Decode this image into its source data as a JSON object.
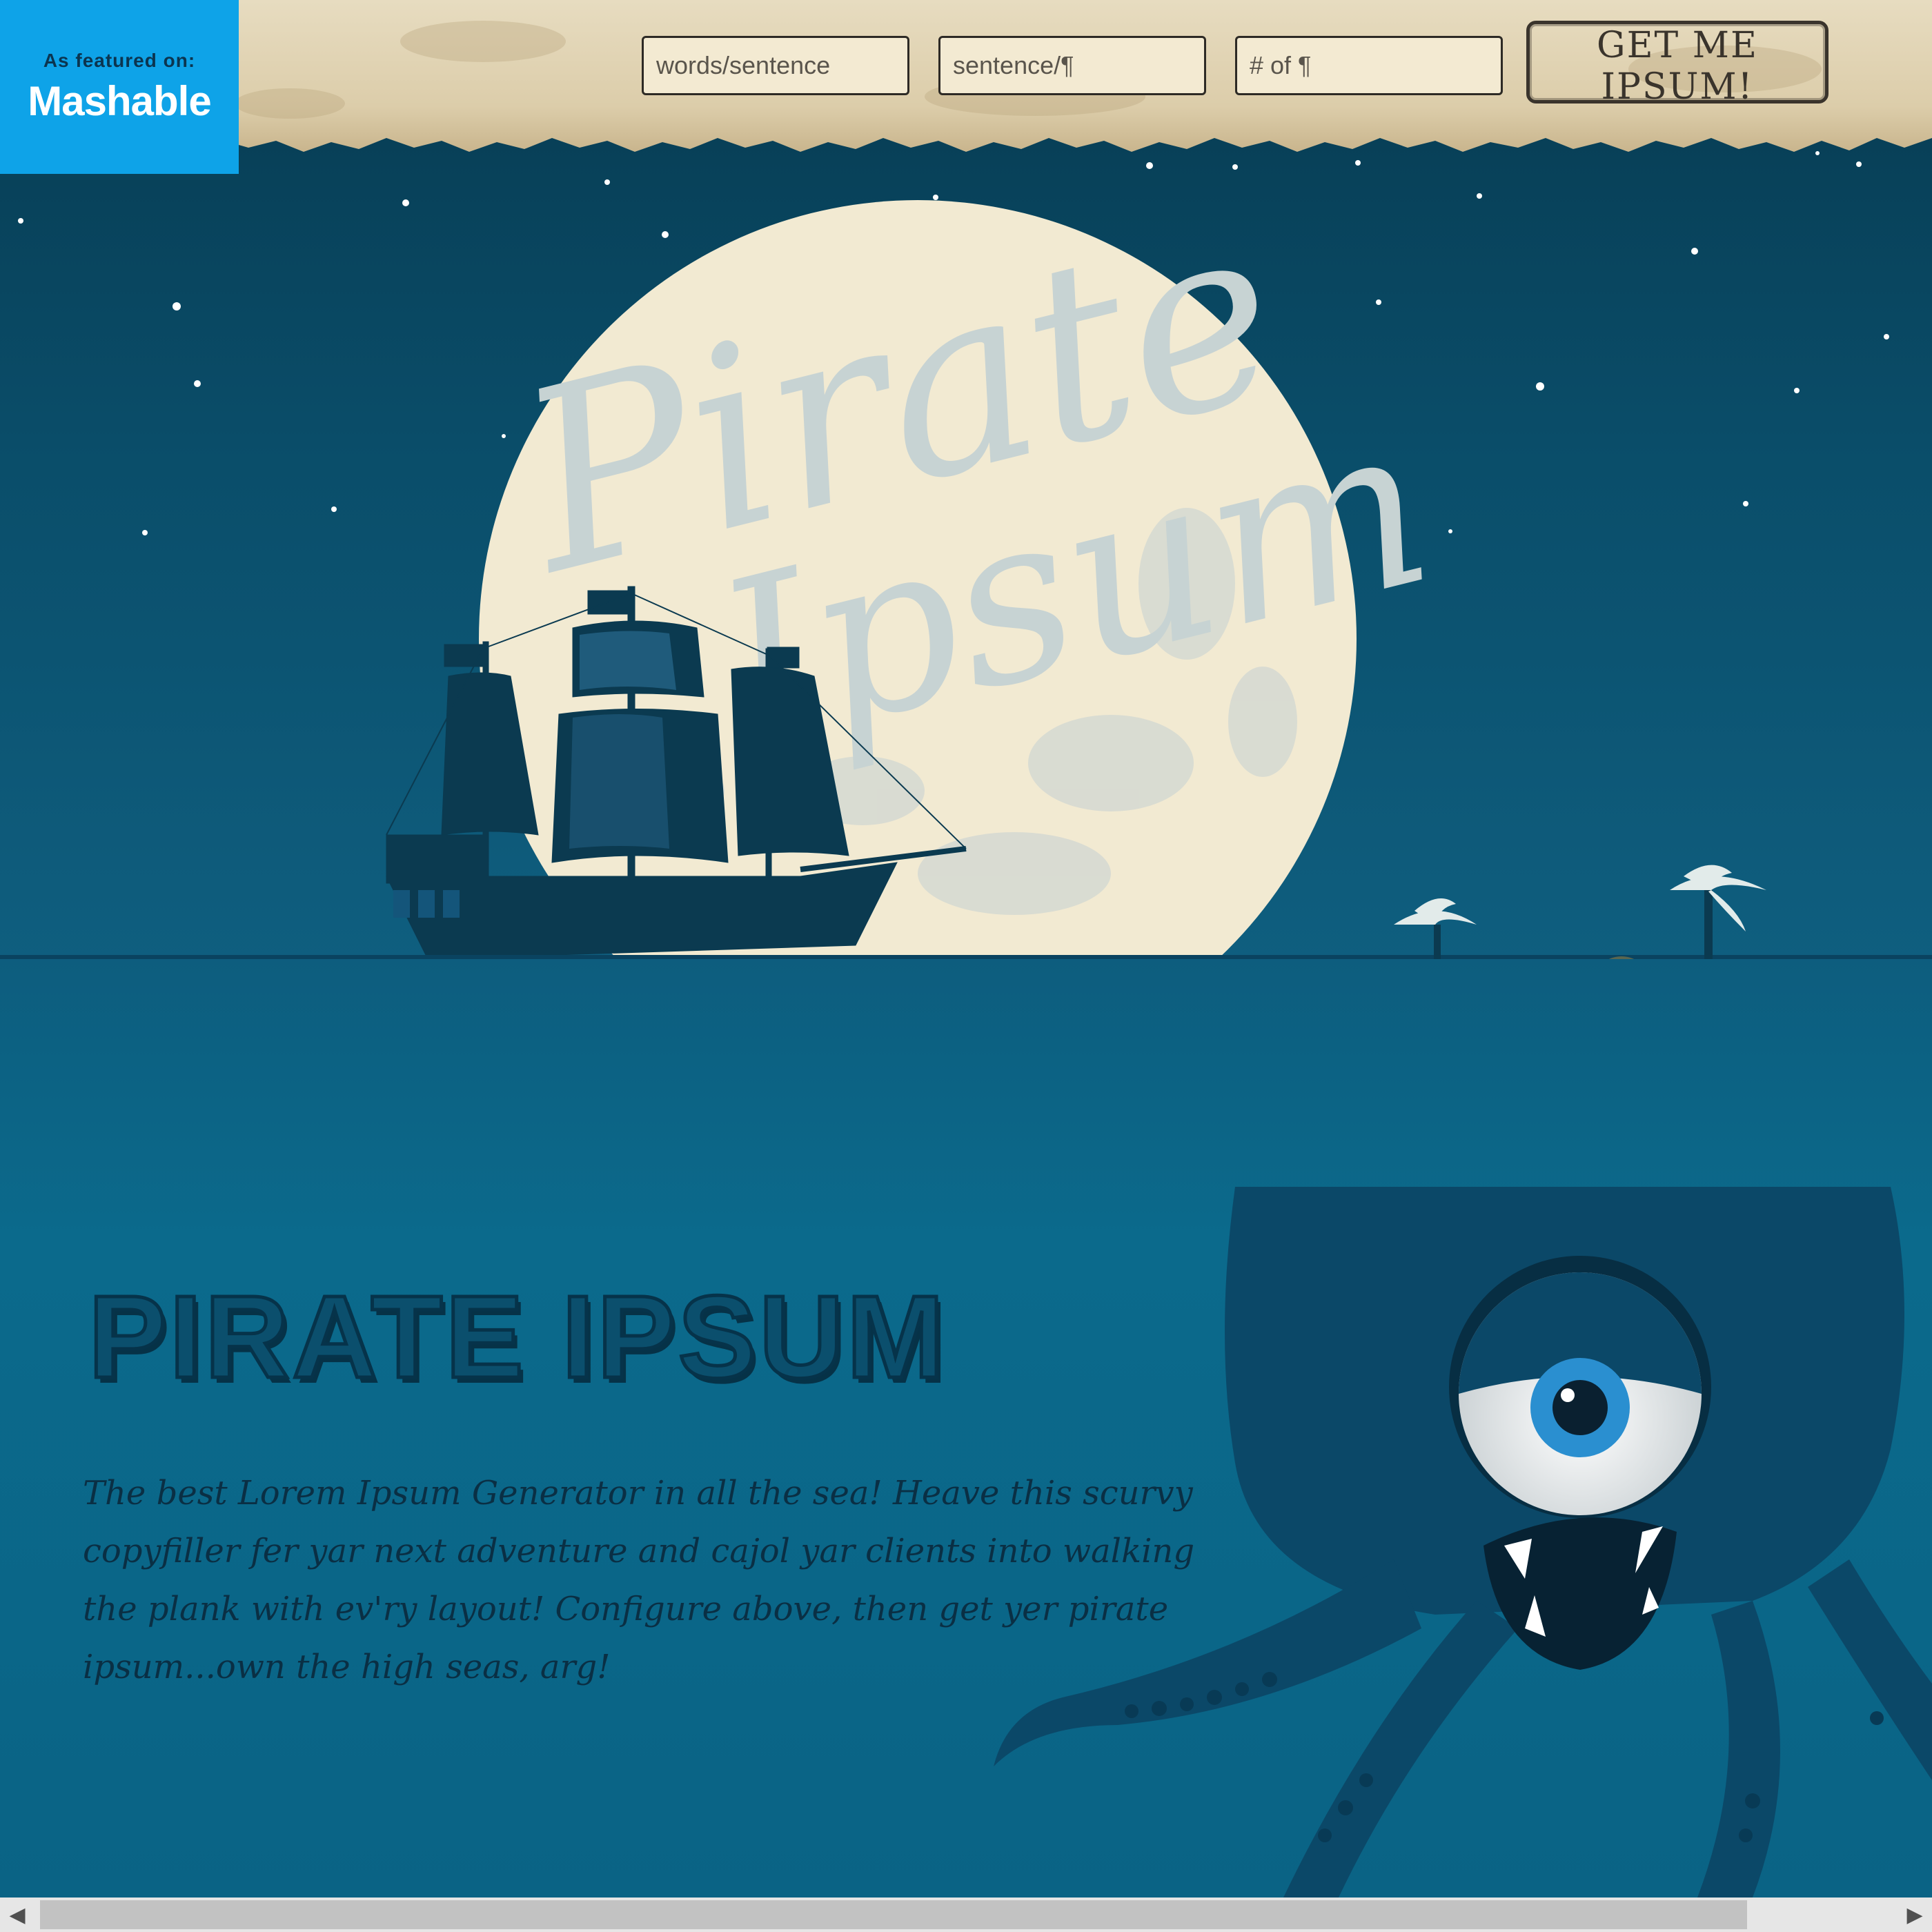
{
  "badge": {
    "featured_label": "As featured on:",
    "brand": "Mashable"
  },
  "controls": {
    "words_per_sentence_placeholder": "words/sentence",
    "sentences_per_paragraph_placeholder": "sentence/¶",
    "paragraph_count_placeholder": "# of ¶",
    "submit_label": "GET ME IPSUM!"
  },
  "hero": {
    "moon_logo_text": [
      "Pirate",
      "Ipsum"
    ]
  },
  "main": {
    "title": "PIRATE IPSUM",
    "description": "The best Lorem Ipsum Generator in all the sea! Heave this scurvy copyfiller fer yar next adventure and cajol yar clients into walking the plank with ev'ry layout! Configure above, then get yer pirate ipsum...own the high seas, arg!"
  },
  "scrollbar": {
    "left_arrow": "◀",
    "right_arrow": "▶"
  },
  "colors": {
    "parchment": "#e2d5b6",
    "sky": "#073a50",
    "sea": "#0a6385",
    "moon": "#f2ead2",
    "brand_blue": "#0ea3e8",
    "ink": "#0a2f44"
  }
}
